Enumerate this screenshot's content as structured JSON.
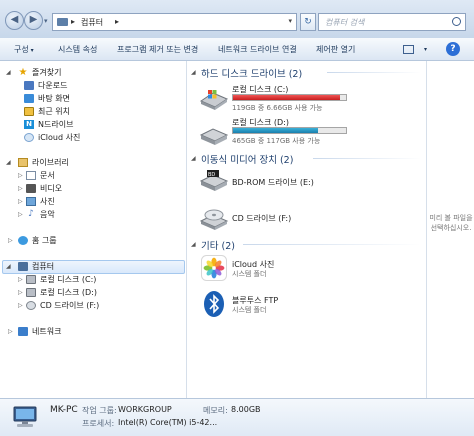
{
  "address": {
    "crumb": "컴퓨터",
    "search_placeholder": "컴퓨터 검색"
  },
  "toolbar": {
    "organize": "구성",
    "system_props": "시스템 속성",
    "uninstall": "프로그램 제거 또는 변경",
    "map_drive": "네트워크 드라이브 연결",
    "control_panel": "제어판 열기",
    "help": "?"
  },
  "nav": {
    "favorites": "즐겨찾기",
    "downloads": "다운로드",
    "desktop": "바탕 화면",
    "recent": "최근 위치",
    "ndrive": "N드라이브",
    "icloud_photos": "iCloud 사진",
    "libraries": "라이브러리",
    "documents": "문서",
    "videos": "비디오",
    "pictures": "사진",
    "music": "음악",
    "homegroup": "홈 그룹",
    "computer": "컴퓨터",
    "drive_c": "로컬 디스크 (C:)",
    "drive_d": "로컬 디스크 (D:)",
    "drive_f": "CD 드라이브 (F:)",
    "network": "네트워크"
  },
  "content": {
    "hdd_group": "하드 디스크 드라이브 (2)",
    "removable_group": "이동식 미디어 장치 (2)",
    "other_group": "기타 (2)",
    "drives": [
      {
        "name": "로컬 디스크 (C:)",
        "space": "119GB 중 6.66GB 사용 가능",
        "used_fraction": 0.944
      },
      {
        "name": "로컬 디스크 (D:)",
        "space": "465GB 중 117GB 사용 가능",
        "used_fraction": 0.748
      }
    ],
    "bdrom": "BD-ROM 드라이브 (E:)",
    "cd": "CD 드라이브 (F:)",
    "icloud_name": "iCloud 사진",
    "icloud_type": "시스템 폴더",
    "bt_name": "블루투스 FTP",
    "bt_type": "시스템 폴더"
  },
  "preview": {
    "message": "미리 볼 파일을 선택하십시오."
  },
  "details": {
    "pc_name": "MK-PC",
    "workgroup_label": "작업 그룹:",
    "workgroup": "WORKGROUP",
    "memory_label": "메모리:",
    "memory": "8.00GB",
    "cpu_label": "프로세서:",
    "cpu": "Intel(R) Core(TM) i5-42..."
  },
  "colors": {
    "accent": "#2d6fd6",
    "drive_c_bar": "#c81e1e",
    "drive_d_bar": "#1a7fae"
  }
}
